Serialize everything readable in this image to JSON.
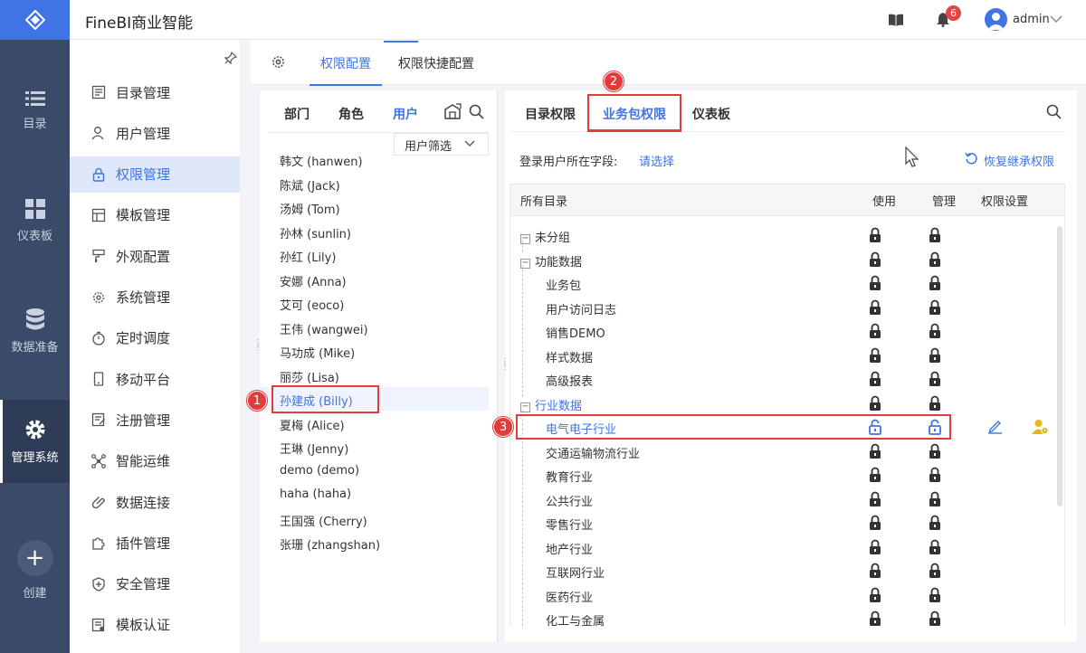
{
  "app": {
    "title": "FineBI商业智能"
  },
  "header": {
    "notification_count": "6",
    "user": "admin"
  },
  "rail": [
    {
      "label": "目录",
      "icon": "list-icon"
    },
    {
      "label": "仪表板",
      "icon": "dashboard-icon"
    },
    {
      "label": "数据准备",
      "icon": "database-icon"
    },
    {
      "label": "管理系统",
      "icon": "gear-icon"
    },
    {
      "label": "创建",
      "icon": "plus-icon"
    }
  ],
  "sidebar": {
    "items": [
      {
        "label": "目录管理",
        "icon": "catalog-icon"
      },
      {
        "label": "用户管理",
        "icon": "user-icon"
      },
      {
        "label": "权限管理",
        "icon": "lock-icon"
      },
      {
        "label": "模板管理",
        "icon": "template-icon"
      },
      {
        "label": "外观配置",
        "icon": "brush-icon"
      },
      {
        "label": "系统管理",
        "icon": "gear-icon"
      },
      {
        "label": "定时调度",
        "icon": "timer-icon"
      },
      {
        "label": "移动平台",
        "icon": "mobile-icon"
      },
      {
        "label": "注册管理",
        "icon": "register-icon"
      },
      {
        "label": "智能运维",
        "icon": "ops-icon"
      },
      {
        "label": "数据连接",
        "icon": "link-icon"
      },
      {
        "label": "插件管理",
        "icon": "plugin-icon"
      },
      {
        "label": "安全管理",
        "icon": "shield-icon"
      },
      {
        "label": "模板认证",
        "icon": "cert-icon"
      }
    ]
  },
  "main_tabs": {
    "config": "权限配置",
    "quick": "权限快捷配置"
  },
  "left_panel": {
    "tabs": {
      "dept": "部门",
      "role": "角色",
      "user": "用户"
    },
    "filter": "用户筛选",
    "users": [
      "韩文 (hanwen)",
      "陈斌 (Jack)",
      "汤姆 (Tom)",
      "孙林 (sunlin)",
      "孙红 (Lily)",
      "安娜 (Anna)",
      "艾可 (eoco)",
      "王伟 (wangwei)",
      "马功成 (Mike)",
      "丽莎 (Lisa)",
      "孙建成 (Billy)",
      "夏梅 (Alice)",
      "王琳 (Jenny)",
      "demo (demo)",
      "haha (haha)",
      "王国强 (Cherry)",
      "张珊 (zhangshan)"
    ]
  },
  "right_panel": {
    "tabs": {
      "catalog": "目录权限",
      "package": "业务包权限",
      "dashboard": "仪表板"
    },
    "field_label": "登录用户所在字段:",
    "field_link": "请选择",
    "restore": "恢复继承权限",
    "columns": {
      "all": "所有目录",
      "use": "使用",
      "manage": "管理",
      "settings": "权限设置"
    },
    "rows": [
      {
        "label": "未分组",
        "level": 0
      },
      {
        "label": "功能数据",
        "level": 0
      },
      {
        "label": "业务包",
        "level": 1
      },
      {
        "label": "用户访问日志",
        "level": 1
      },
      {
        "label": "销售DEMO",
        "level": 1
      },
      {
        "label": "样式数据",
        "level": 1
      },
      {
        "label": "高级报表",
        "level": 1
      },
      {
        "label": "行业数据",
        "level": 0
      },
      {
        "label": "电气电子行业",
        "level": 1
      },
      {
        "label": "交通运输物流行业",
        "level": 1
      },
      {
        "label": "教育行业",
        "level": 1
      },
      {
        "label": "公共行业",
        "level": 1
      },
      {
        "label": "零售行业",
        "level": 1
      },
      {
        "label": "地产行业",
        "level": 1
      },
      {
        "label": "互联网行业",
        "level": 1
      },
      {
        "label": "医药行业",
        "level": 1
      },
      {
        "label": "化工与金属",
        "level": 1
      }
    ]
  },
  "markers": [
    "1",
    "2",
    "3"
  ],
  "colors": {
    "accent": "#3f73e6",
    "highlight": "#e03c3c",
    "rail": "#3a4a68"
  }
}
